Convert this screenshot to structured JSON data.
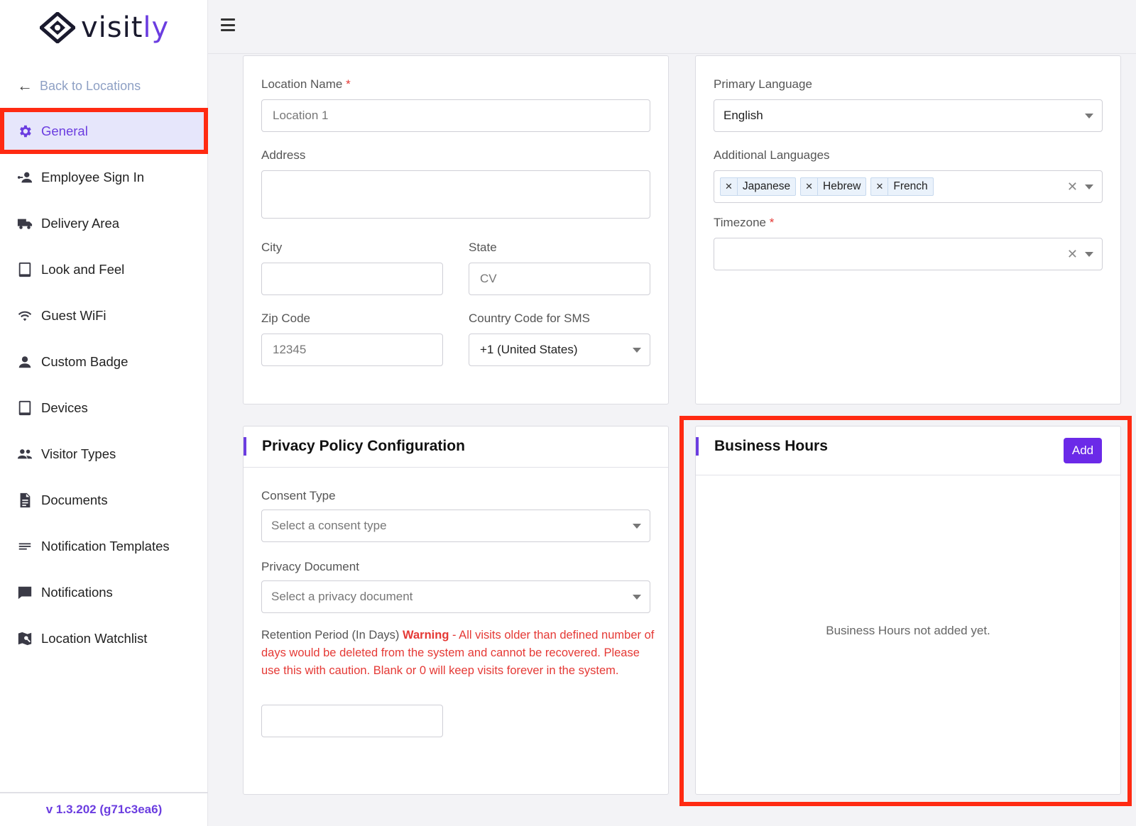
{
  "brand": {
    "name_main": "visit",
    "name_accent": "ly",
    "accent_color": "#6b3de0"
  },
  "sidebar": {
    "back_label": "Back to Locations",
    "items": [
      {
        "label": "General",
        "icon": "gear-icon",
        "active": true
      },
      {
        "label": "Employee Sign In",
        "icon": "employee-sign-in-icon"
      },
      {
        "label": "Delivery Area",
        "icon": "truck-icon"
      },
      {
        "label": "Look and Feel",
        "icon": "tablet-icon"
      },
      {
        "label": "Guest WiFi",
        "icon": "wifi-icon"
      },
      {
        "label": "Custom Badge",
        "icon": "person-icon"
      },
      {
        "label": "Devices",
        "icon": "tablet-icon"
      },
      {
        "label": "Visitor Types",
        "icon": "people-icon"
      },
      {
        "label": "Documents",
        "icon": "document-icon"
      },
      {
        "label": "Notification Templates",
        "icon": "notes-icon"
      },
      {
        "label": "Notifications",
        "icon": "chat-icon"
      },
      {
        "label": "Location Watchlist",
        "icon": "map-watch-icon"
      }
    ],
    "version": "v 1.3.202 (g71c3ea6)"
  },
  "location_form": {
    "name_label": "Location Name",
    "name_value": "Location 1",
    "address_label": "Address",
    "address_value": "",
    "city_label": "City",
    "city_value": "",
    "state_label": "State",
    "state_value": "CV",
    "zip_label": "Zip Code",
    "zip_value": "12345",
    "country_code_label": "Country Code for SMS",
    "country_code_value": "+1 (United States)"
  },
  "language_form": {
    "primary_label": "Primary Language",
    "primary_value": "English",
    "additional_label": "Additional Languages",
    "additional_values": [
      "Japanese",
      "Hebrew",
      "French"
    ],
    "timezone_label": "Timezone",
    "timezone_value": ""
  },
  "privacy": {
    "title": "Privacy Policy Configuration",
    "consent_label": "Consent Type",
    "consent_placeholder": "Select a consent type",
    "document_label": "Privacy Document",
    "document_placeholder": "Select a privacy document",
    "retention_label": "Retention Period (In Days)",
    "retention_warning_title": "Warning",
    "retention_warning_text": "- All visits older than defined number of days would be deleted from the system and cannot be recovered. Please use this with caution. Blank or 0 will keep visits forever in the system.",
    "retention_value": ""
  },
  "business_hours": {
    "title": "Business Hours",
    "add_label": "Add",
    "empty_message": "Business Hours not added yet."
  },
  "required_mark": "*"
}
